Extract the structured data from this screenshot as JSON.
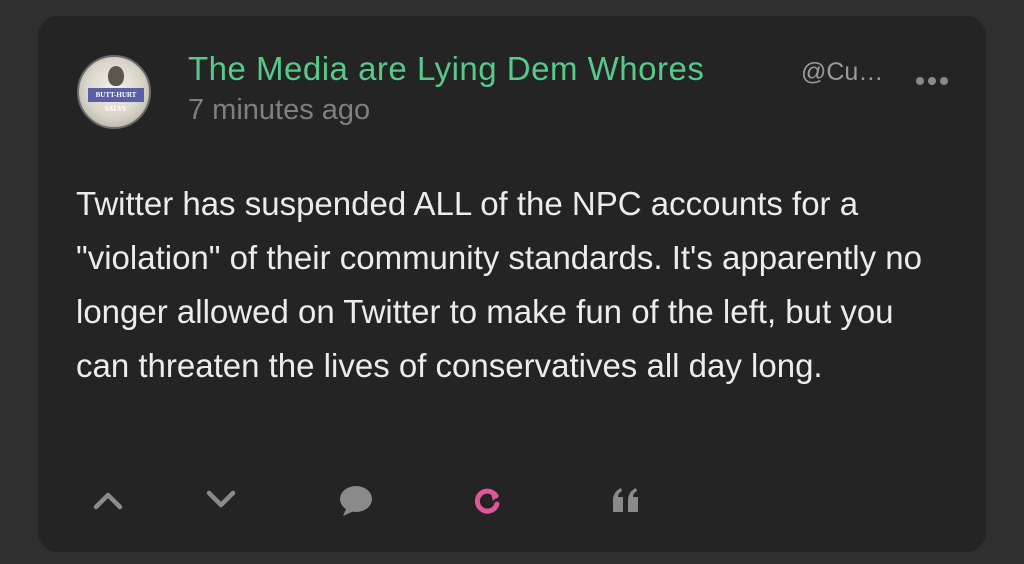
{
  "post": {
    "author_name": "The Media are Lying Dem Whores",
    "handle": "@Cu…",
    "timestamp": "7 minutes ago",
    "body": "Twitter has suspended ALL of the NPC accounts for a \"violation\" of their community standards. It's apparently no longer allowed on Twitter to make fun of the left, but you can threaten the lives of conservatives all day long.",
    "avatar_label": "BUTT-HURT SALVE"
  },
  "icons": {
    "avatar": "avatar-image",
    "more": "more-options-icon",
    "up": "upvote-icon",
    "down": "downvote-icon",
    "comment": "comment-icon",
    "repost": "repost-icon",
    "quote": "quote-icon"
  },
  "colors": {
    "background": "#2f2f2f",
    "card": "#242424",
    "author": "#57c98a",
    "body_text": "#ececec",
    "muted": "#7f7f7f",
    "action_icon": "#8a8a8a",
    "repost_accent": "#e0569a"
  }
}
